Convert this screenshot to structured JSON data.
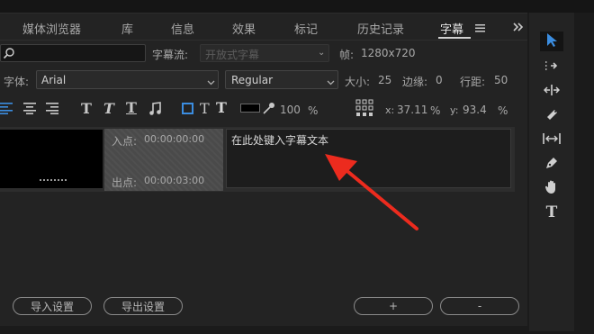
{
  "header": {
    "tabs": [
      {
        "label": "媒体浏览器"
      },
      {
        "label": "库"
      },
      {
        "label": "信息"
      },
      {
        "label": "效果"
      },
      {
        "label": "标记"
      },
      {
        "label": "历史记录"
      },
      {
        "label": "字幕"
      }
    ],
    "active_tab": "字幕",
    "menu_icon": "hamburger-icon",
    "overflow_icon": "double-chevron-right-icon"
  },
  "search_row": {
    "search_icon": "search-icon",
    "search_placeholder": "",
    "stream_label": "字幕流:",
    "stream_value": "开放式字幕",
    "frame_label": "帧:",
    "frame_value": "1280x720"
  },
  "font_row": {
    "font_label": "字体:",
    "font_value": "Arial",
    "style_value": "Regular",
    "size_label": "大小:",
    "size_value": "25",
    "edge_label": "边缘:",
    "edge_value": "0",
    "spacing_label": "行距:",
    "spacing_value": "50"
  },
  "format_row": {
    "opacity_value": "100",
    "opacity_unit": "%",
    "x_label": "x:",
    "x_value": "37.11",
    "x_unit": "%",
    "y_label": "y:",
    "y_value": "93.4",
    "y_unit": "%",
    "colors": {
      "fill": "#000000",
      "accent": "#2f7fd6"
    }
  },
  "clip": {
    "in_label": "入点:",
    "in_value": "00:00:00:00",
    "out_label": "出点:",
    "out_value": "00:00:03:00",
    "caption_text": "在此处键入字幕文本"
  },
  "footer": {
    "import_label": "导入设置",
    "export_label": "导出设置",
    "add_label": "+",
    "remove_label": "-"
  },
  "tools": [
    {
      "name": "selection-tool",
      "icon": "arrow-icon",
      "active": true
    },
    {
      "name": "track-select-tool",
      "icon": "track-select-icon"
    },
    {
      "name": "ripple-edit-tool",
      "icon": "ripple-edit-icon"
    },
    {
      "name": "razor-tool",
      "icon": "razor-icon"
    },
    {
      "name": "slip-tool",
      "icon": "slip-icon"
    },
    {
      "name": "pen-tool",
      "icon": "pen-icon"
    },
    {
      "name": "hand-tool",
      "icon": "hand-icon"
    },
    {
      "name": "type-tool",
      "icon": "type-icon"
    }
  ]
}
